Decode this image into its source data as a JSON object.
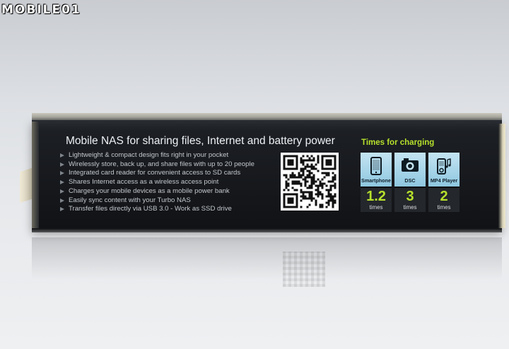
{
  "watermark": {
    "text": "MOBILE01"
  },
  "box": {
    "headline": "Mobile NAS for sharing files, Internet and battery power",
    "features": [
      "Lightweight & compact design fits right in your pocket",
      "Wirelessly store, back up, and share files with up to 20 people",
      "Integrated card reader for convenient access to SD cards",
      "Shares Internet access as a wireless access point",
      "Charges your mobile devices as a mobile power bank",
      "Easily sync content with your Turbo NAS",
      "Transfer files directly via USB 3.0 - Work as SSD drive"
    ],
    "charging": {
      "title": "Times for charging",
      "devices": [
        {
          "label": "Smartphone",
          "value": "1.2",
          "unit": "times",
          "icon": "smartphone-icon"
        },
        {
          "label": "DSC",
          "value": "3",
          "unit": "times",
          "icon": "camera-icon"
        },
        {
          "label": "MP4 Player",
          "value": "2",
          "unit": "times",
          "icon": "mp4-player-icon"
        }
      ]
    }
  },
  "colors": {
    "accent": "#b6e12c",
    "box": "#16181c",
    "tile": "#a8d5ea"
  }
}
